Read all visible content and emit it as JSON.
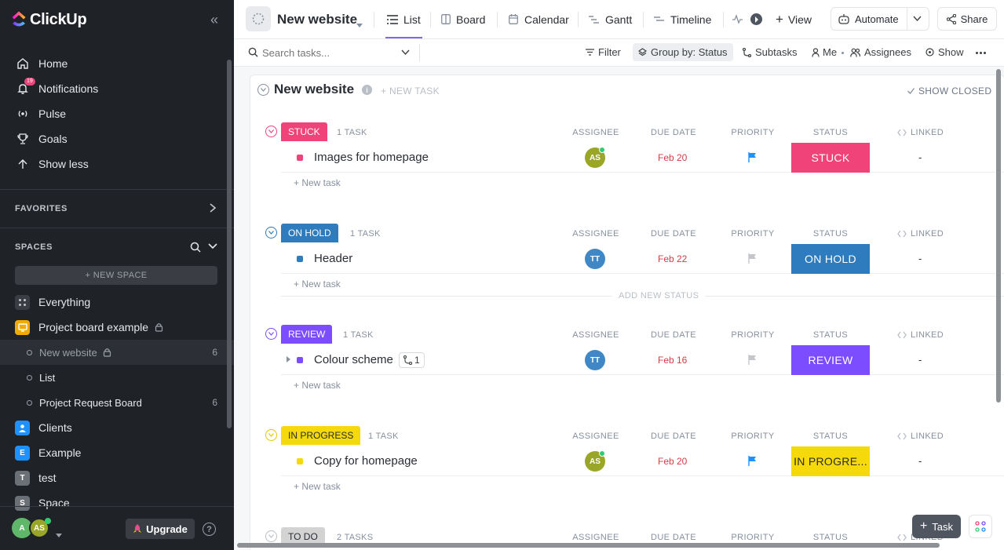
{
  "app": {
    "logo_text": "ClickUp"
  },
  "sidebar": {
    "nav": [
      {
        "label": "Home",
        "icon": "home-icon"
      },
      {
        "label": "Notifications",
        "icon": "bell-icon",
        "badge": "19"
      },
      {
        "label": "Pulse",
        "icon": "pulse-icon"
      },
      {
        "label": "Goals",
        "icon": "trophy-icon"
      },
      {
        "label": "Show less",
        "icon": "arrow-up-icon"
      }
    ],
    "favorites_label": "FAVORITES",
    "spaces_label": "SPACES",
    "new_space_label": "+ NEW SPACE",
    "everything_label": "Everything",
    "spaces": [
      {
        "label": "Project board example",
        "color": "#f2a900",
        "letter": ""
      },
      {
        "label": "Clients",
        "color": "#1e90ff",
        "letter": ""
      },
      {
        "label": "Example",
        "color": "#1e90ff",
        "letter": "E"
      },
      {
        "label": "test",
        "color": "#6b6f76",
        "letter": "T"
      },
      {
        "label": "Space",
        "color": "#6b6f76",
        "letter": "S"
      }
    ],
    "lists": [
      {
        "label": "New website",
        "count": "6"
      },
      {
        "label": "List",
        "count": ""
      },
      {
        "label": "Project Request Board",
        "count": "6"
      }
    ],
    "footer": {
      "avatar_a": "A",
      "avatar_as": "AS",
      "upgrade_label": "Upgrade"
    }
  },
  "topbar": {
    "title": "New website",
    "tabs": [
      {
        "label": "List"
      },
      {
        "label": "Board"
      },
      {
        "label": "Calendar"
      },
      {
        "label": "Gantt"
      },
      {
        "label": "Timeline"
      }
    ],
    "add_view_label": "View",
    "automate_label": "Automate",
    "share_label": "Share"
  },
  "toolbar": {
    "search_placeholder": "Search tasks...",
    "filter_label": "Filter",
    "group_by_label": "Group by: Status",
    "subtasks_label": "Subtasks",
    "me_label": "Me",
    "assignees_label": "Assignees",
    "show_label": "Show"
  },
  "list": {
    "title": "New website",
    "new_task_header": "+ NEW TASK",
    "show_closed": "SHOW CLOSED",
    "add_new_status": "ADD NEW STATUS",
    "new_task_label": "+ New task",
    "columns": {
      "assignee": "ASSIGNEE",
      "due_date": "DUE DATE",
      "priority": "PRIORITY",
      "status": "STATUS",
      "linked": "LINKED"
    },
    "groups": [
      {
        "status": "STUCK",
        "count": "1 TASK",
        "color": "#f0437a",
        "task": {
          "name": "Images for homepage",
          "assignee": "AS",
          "assignee_color": "#9aa628",
          "due": "Feb 20",
          "priority_color": "#1e90ff",
          "status_text": "STUCK",
          "linked": "-"
        }
      },
      {
        "status": "ON HOLD",
        "count": "1 TASK",
        "color": "#2e7bbd",
        "task": {
          "name": "Header",
          "assignee": "TT",
          "assignee_color": "#3f88c5",
          "due": "Feb 22",
          "priority_color": "#c4c6cb",
          "status_text": "ON HOLD",
          "linked": "-"
        }
      },
      {
        "status": "REVIEW",
        "count": "1 TASK",
        "color": "#7c4dff",
        "task": {
          "name": "Colour scheme",
          "subtask_count": "1",
          "assignee": "TT",
          "assignee_color": "#3f88c5",
          "due": "Feb 16",
          "priority_color": "#c4c6cb",
          "status_text": "REVIEW",
          "linked": "-"
        }
      },
      {
        "status": "IN PROGRESS",
        "count": "1 TASK",
        "color": "#f5d90a",
        "task": {
          "name": "Copy for homepage",
          "assignee": "AS",
          "assignee_color": "#9aa628",
          "due": "Feb 20",
          "priority_color": "#1e90ff",
          "status_text": "IN PROGRE...",
          "linked": "-"
        }
      },
      {
        "status": "TO DO",
        "count": "2 TASKS",
        "color": "#d3d3d3"
      }
    ]
  },
  "fab": {
    "task_label": "Task"
  }
}
